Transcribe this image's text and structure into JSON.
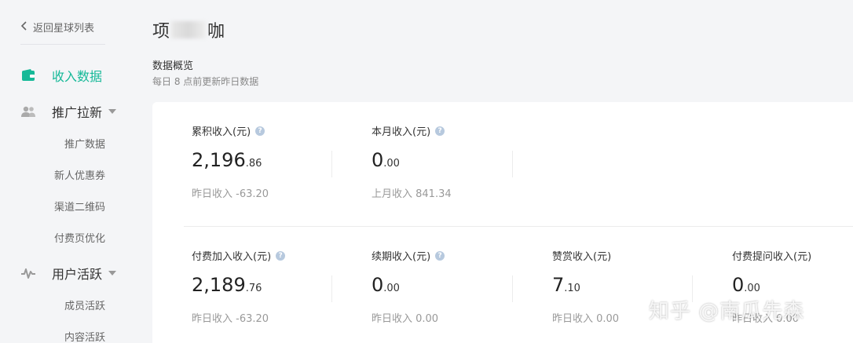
{
  "sidebar": {
    "back_label": "返回星球列表",
    "items": [
      {
        "label": "收入数据",
        "icon": "wallet-icon",
        "active": true
      },
      {
        "label": "推广拉新",
        "icon": "users-icon",
        "subs": [
          "推广数据",
          "新人优惠券",
          "渠道二维码",
          "付费页优化"
        ]
      },
      {
        "label": "用户活跃",
        "icon": "pulse-icon",
        "subs": [
          "成员活跃",
          "内容活跃"
        ]
      }
    ]
  },
  "header": {
    "title_start": "项",
    "title_end": "咖"
  },
  "overview": {
    "title": "数据概览",
    "subtitle": "每日 8 点前更新昨日数据"
  },
  "metrics_row1": [
    {
      "label": "累积收入(元)",
      "help": true,
      "int": "2,196",
      "dec": ".86",
      "sub": "昨日收入 -63.20"
    },
    {
      "label": "本月收入(元)",
      "help": true,
      "int": "0",
      "dec": ".00",
      "sub": "上月收入 841.34"
    }
  ],
  "metrics_row2": [
    {
      "label": "付费加入收入(元)",
      "help": true,
      "int": "2,189",
      "dec": ".76",
      "sub": "昨日收入 -63.20"
    },
    {
      "label": "续期收入(元)",
      "help": true,
      "int": "0",
      "dec": ".00",
      "sub": "昨日收入 0.00"
    },
    {
      "label": "赞赏收入(元)",
      "help": false,
      "int": "7",
      "dec": ".10",
      "sub": "昨日收入 0.00"
    },
    {
      "label": "付费提问收入(元)",
      "help": false,
      "int": "0",
      "dec": ".00",
      "sub": "昨日收入 0.00"
    }
  ],
  "help_glyph": "?",
  "watermark": "知乎 @南瓜先森",
  "colors": {
    "accent": "#16b998",
    "background": "#f4f5f7",
    "card": "#ffffff"
  }
}
